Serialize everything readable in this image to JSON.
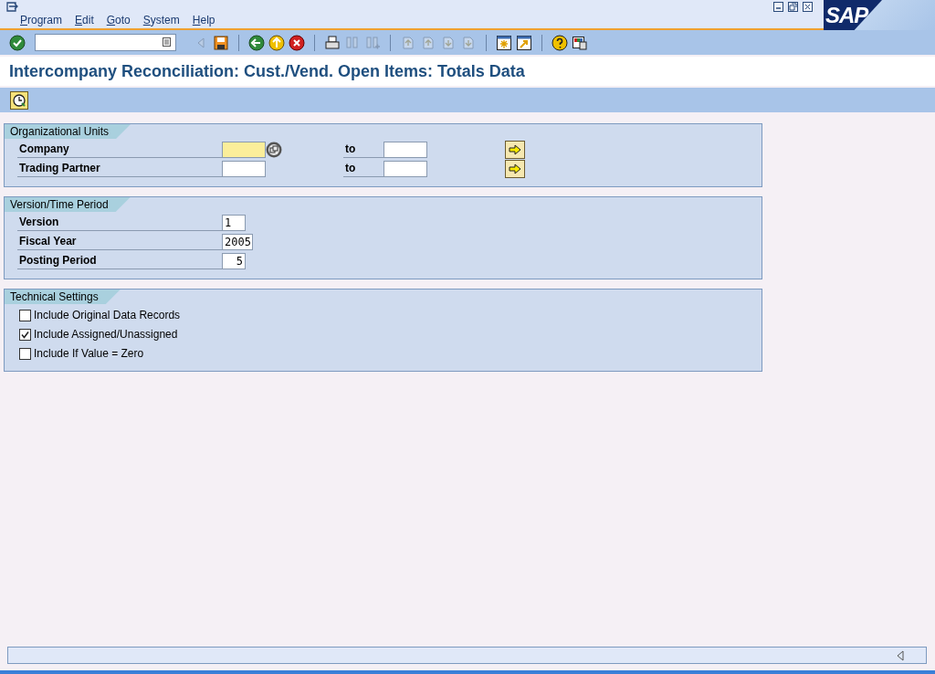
{
  "menu": [
    {
      "label": "Program"
    },
    {
      "label": "Edit"
    },
    {
      "label": "Goto"
    },
    {
      "label": "System"
    },
    {
      "label": "Help"
    }
  ],
  "logo": "SAP",
  "toolbar": [
    {
      "kind": "enter",
      "disabled": false
    },
    {
      "kind": "command"
    },
    {
      "kind": "previous",
      "disabled": true
    },
    {
      "kind": "save",
      "disabled": false
    },
    {
      "kind": "sep"
    },
    {
      "kind": "back",
      "disabled": false
    },
    {
      "kind": "exit",
      "disabled": false
    },
    {
      "kind": "cancel",
      "disabled": false
    },
    {
      "kind": "sep"
    },
    {
      "kind": "print",
      "disabled": false
    },
    {
      "kind": "find",
      "disabled": true
    },
    {
      "kind": "findnext",
      "disabled": true
    },
    {
      "kind": "sep"
    },
    {
      "kind": "first",
      "disabled": true
    },
    {
      "kind": "prev",
      "disabled": true
    },
    {
      "kind": "next",
      "disabled": true
    },
    {
      "kind": "last",
      "disabled": true
    },
    {
      "kind": "sep"
    },
    {
      "kind": "session",
      "disabled": false
    },
    {
      "kind": "shortcut",
      "disabled": false
    },
    {
      "kind": "sep"
    },
    {
      "kind": "help",
      "disabled": false
    },
    {
      "kind": "layout",
      "disabled": false
    }
  ],
  "title": "Intercompany Reconciliation: Cust./Vend. Open Items: Totals Data",
  "groups": [
    {
      "kind": "ranges",
      "title": "Organizational Units",
      "rows": [
        {
          "label": "Company",
          "highlighted": true,
          "search_help": true,
          "to_label": "to"
        },
        {
          "label": "Trading Partner",
          "highlighted": false,
          "search_help": false,
          "to_label": "to"
        }
      ]
    },
    {
      "kind": "fields",
      "title": "Version/Time Period",
      "rows": [
        {
          "label": "Version",
          "value": "1",
          "right_aligned": false
        },
        {
          "label": "Fiscal Year",
          "value": "2005"
        },
        {
          "label": "Posting Period",
          "value": "5",
          "right_aligned": true
        }
      ]
    },
    {
      "kind": "checks",
      "title": "Technical Settings",
      "rows": [
        {
          "label": "Include Original Data Records",
          "checked": false
        },
        {
          "label": "Include Assigned/Unassigned",
          "checked": true
        },
        {
          "label": "Include If Value = Zero",
          "checked": false
        }
      ]
    }
  ]
}
